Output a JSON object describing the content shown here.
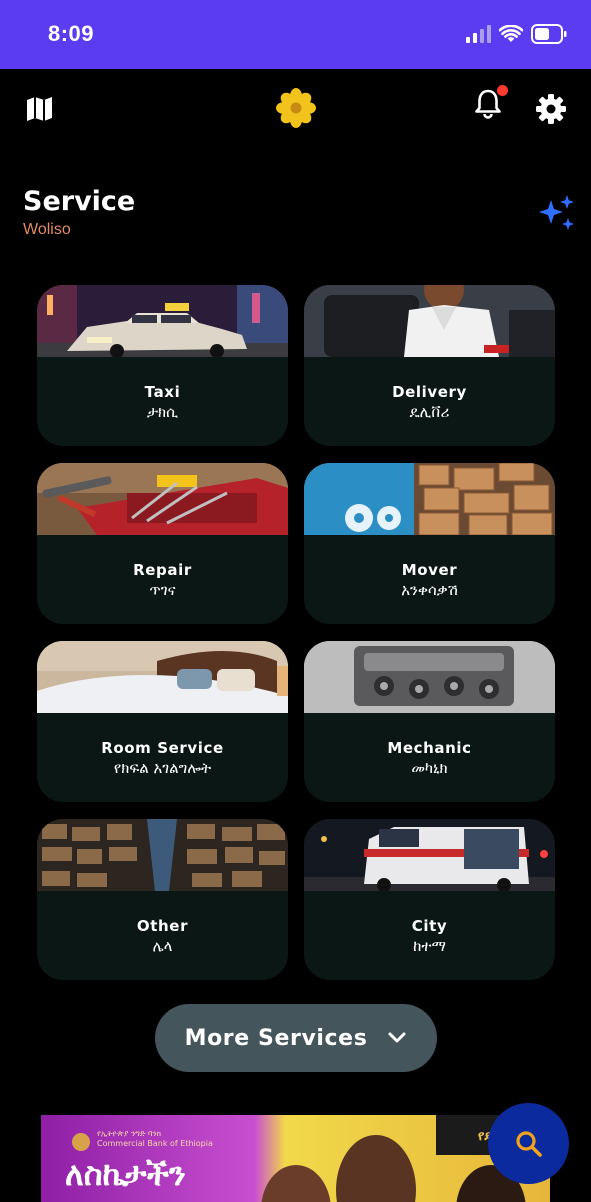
{
  "status_bar": {
    "time": "8:09",
    "background": "#5b3cf0"
  },
  "top_bar": {
    "left_icon": "map-icon",
    "center_icon": "flower-logo-icon",
    "bell_icon": "bell-icon",
    "settings_icon": "gear-icon",
    "notification_dot_color": "#ff3b30"
  },
  "section": {
    "title": "Service",
    "subtitle": "Woliso",
    "action_icon": "sparkles-icon"
  },
  "services": [
    {
      "id": "taxi",
      "name": "Taxi",
      "name_am": "ታክሲ"
    },
    {
      "id": "delivery",
      "name": "Delivery",
      "name_am": "ዴሊቨሪ"
    },
    {
      "id": "repair",
      "name": "Repair",
      "name_am": "ጥገና"
    },
    {
      "id": "mover",
      "name": "Mover",
      "name_am": "አንቀሳቃሽ"
    },
    {
      "id": "room-service",
      "name": "Room Service",
      "name_am": "የክፍል አገልግሎት"
    },
    {
      "id": "mechanic",
      "name": "Mechanic",
      "name_am": "መካኒክ"
    },
    {
      "id": "other",
      "name": "Other",
      "name_am": "ሌላ"
    },
    {
      "id": "city",
      "name": "City",
      "name_am": "ከተማ"
    }
  ],
  "more_button": {
    "label": "More Services",
    "icon": "chevron-down-icon"
  },
  "banner": {
    "headline": "ለስኬታችን",
    "bank_am": "የኢትዮጵያ ንግድ ባንክ",
    "bank_en": "Commercial Bank of Ethiopia",
    "right_text": "የደንበኞ"
  },
  "fab": {
    "icon": "search-icon",
    "color": "#0b2a9e"
  }
}
